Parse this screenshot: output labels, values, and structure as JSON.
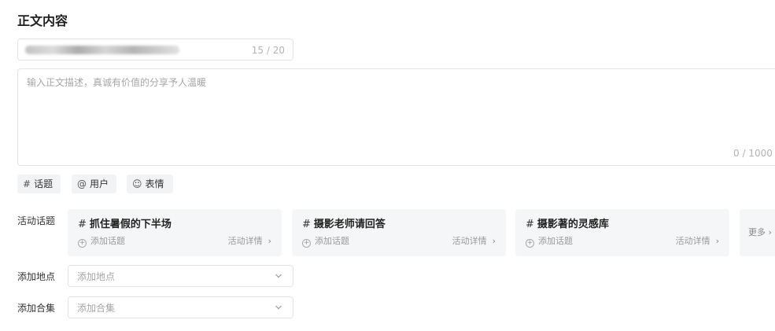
{
  "section": {
    "title": "正文内容"
  },
  "title_input": {
    "count": "15 / 20"
  },
  "description": {
    "placeholder": "输入正文描述，真诚有价值的分享予人温暖",
    "count": "0 / 1000"
  },
  "toolbar": {
    "topic": {
      "icon": "hash-icon",
      "glyph": "#",
      "label": "话题"
    },
    "user": {
      "icon": "at-icon",
      "glyph": "@",
      "label": "用户"
    },
    "emoji": {
      "icon": "smiley-icon",
      "glyph": "☺",
      "label": "表情"
    }
  },
  "activity": {
    "label": "活动话题",
    "cards": [
      {
        "hash": "#",
        "title": "抓住暑假的下半场",
        "add": "添加话题",
        "detail": "活动详情",
        "chevron": "›"
      },
      {
        "hash": "#",
        "title": "摄影老师请回答",
        "add": "添加话题",
        "detail": "活动详情",
        "chevron": "›"
      },
      {
        "hash": "#",
        "title": "摄影著的灵感库",
        "add": "添加话题",
        "detail": "活动详情",
        "chevron": "›"
      }
    ],
    "more": "更多 ›"
  },
  "location": {
    "label": "添加地点",
    "placeholder": "添加地点"
  },
  "collection": {
    "label": "添加合集",
    "placeholder": "添加合集"
  }
}
